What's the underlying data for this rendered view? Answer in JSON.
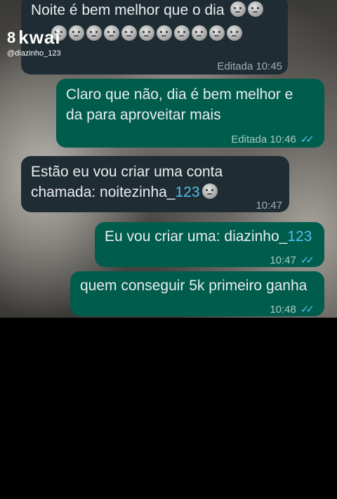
{
  "watermark": {
    "logo_mark": "8",
    "logo_text": "kwai",
    "username": "@diazinho_123"
  },
  "messages": [
    {
      "direction": "in",
      "text": "Noite é bem melhor que o dia",
      "time": "Editada 10:45",
      "emoji_count_line1": 2,
      "emoji_count_line2": 11,
      "emoji": "new-moon-face"
    },
    {
      "direction": "out",
      "line1": "Claro que não, dia é bem melhor e",
      "line2": "da para aproveitar mais",
      "time": "Editada 10:46",
      "ticks": "✓✓"
    },
    {
      "direction": "in",
      "line1": "Estão eu vou criar uma conta",
      "line2_prefix": "chamada: noitezinha_",
      "line2_handle": "123",
      "time": "10:47",
      "emoji": "new-moon-face"
    },
    {
      "direction": "out",
      "prefix": "Eu vou criar uma: diazinho_",
      "handle": "123",
      "time": "10:47",
      "ticks": "✓✓"
    },
    {
      "direction": "out",
      "text": "quem conseguir 5k primeiro ganha",
      "time": "10:48",
      "ticks": "✓✓"
    }
  ]
}
